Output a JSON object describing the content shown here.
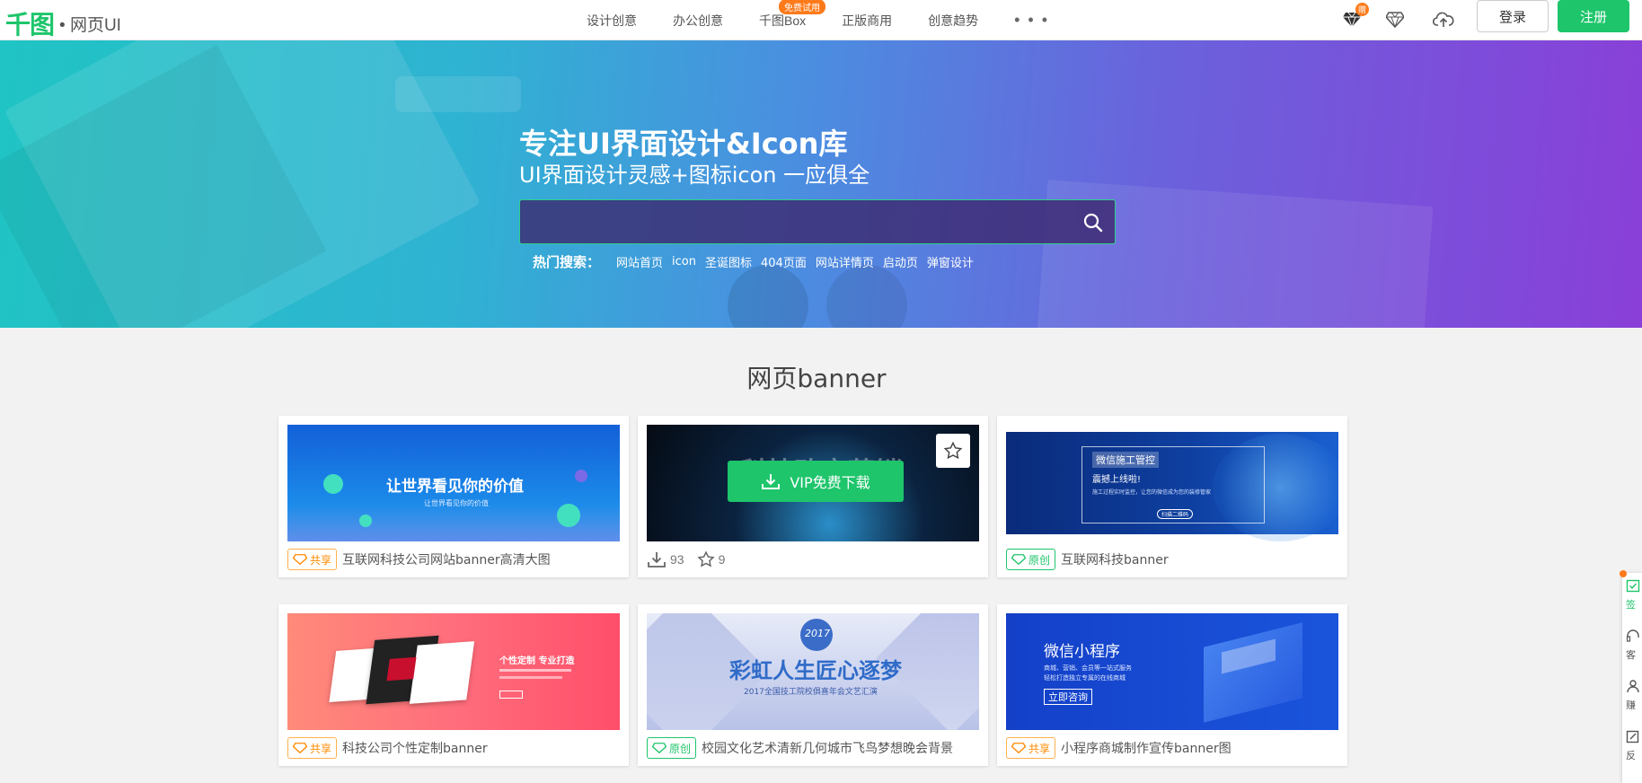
{
  "brand": {
    "logo": "千图",
    "section": "• 网页UI",
    "accent": "#1ec56b"
  },
  "nav": {
    "items": [
      {
        "label": "设计创意"
      },
      {
        "label": "办公创意"
      },
      {
        "label": "千图Box",
        "badge": "免费试用"
      },
      {
        "label": "正版商用"
      },
      {
        "label": "创意趋势"
      }
    ],
    "more": "• • •"
  },
  "header": {
    "gift_badge": "赠",
    "login": "登录",
    "register": "注册"
  },
  "hero": {
    "title": "专注UI界面设计&Icon库",
    "subtitle": "UI界面设计灵感+图标icon 一应俱全",
    "search_value": "",
    "hot_label": "热门搜索：",
    "hot_tags": [
      "网站首页",
      "icon",
      "圣诞图标",
      "404页面",
      "网站详情页",
      "启动页",
      "弹窗设计"
    ]
  },
  "section": {
    "title": "网页banner"
  },
  "cards": [
    {
      "tag": "共享",
      "name": "互联网科技公司网站banner高清大图",
      "thumb_title": "让世界看见你的价值",
      "thumb_sub": "让世界看见你的价值"
    },
    {
      "overlay_button": "VIP免费下载",
      "downloads": "93",
      "favorites": "9",
      "thumb_title": "科技改变营销"
    },
    {
      "tag": "原创",
      "name": "互联网科技banner",
      "thumb_title": "微信施工管控",
      "thumb_line": "震撼上线啦!",
      "thumb_desc": "施工过程实时监控，让您的微信成为您的装修管家",
      "thumb_btn": "扫描二维码"
    },
    {
      "tag": "共享",
      "name": "科技公司个性定制banner",
      "thumb_title": "个性定制 专业打造"
    },
    {
      "tag": "原创",
      "name": "校园文化艺术清新几何城市飞鸟梦想晚会背景",
      "thumb_title": "彩虹人生匠心逐梦",
      "thumb_year": "2017",
      "thumb_sub": "2017全国技工院校俱喜年会文艺汇演"
    },
    {
      "tag": "共享",
      "name": "小程序商城制作宣传banner图",
      "thumb_title": "微信小程序",
      "thumb_line1": "商城、营销、会员等一站式服务",
      "thumb_line2": "轻松打造独立专属的在线商城",
      "thumb_btn": "立即咨询"
    }
  ],
  "sidebar": {
    "items": [
      "签",
      "客",
      "赚",
      "反"
    ]
  }
}
